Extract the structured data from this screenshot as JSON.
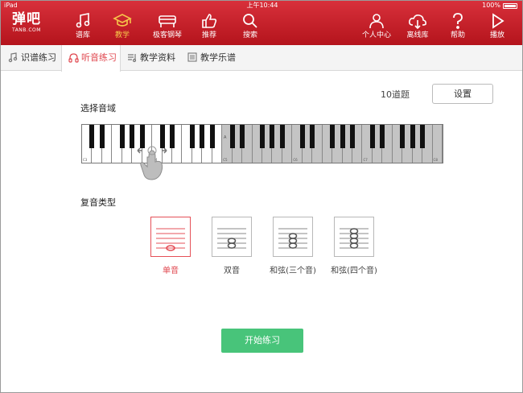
{
  "status": {
    "device": "iPad",
    "time": "上午10:44",
    "battery": "100%"
  },
  "logo": {
    "main": "弹吧",
    "sub": "TANB.COM"
  },
  "nav": {
    "left": [
      {
        "label": "谱库",
        "icon": "music-note-icon"
      },
      {
        "label": "教学",
        "icon": "graduation-cap-icon",
        "active": true
      },
      {
        "label": "极客钢琴",
        "icon": "piano-icon"
      },
      {
        "label": "推荐",
        "icon": "thumbs-up-icon"
      },
      {
        "label": "搜索",
        "icon": "search-icon"
      }
    ],
    "right": [
      {
        "label": "个人中心",
        "icon": "user-icon"
      },
      {
        "label": "离线库",
        "icon": "cloud-download-icon"
      },
      {
        "label": "帮助",
        "icon": "help-icon"
      },
      {
        "label": "播放",
        "icon": "play-icon"
      }
    ]
  },
  "tabs": [
    {
      "label": "识谱练习",
      "icon": "music-note-icon"
    },
    {
      "label": "听音练习",
      "icon": "headphones-icon",
      "active": true
    },
    {
      "label": "教学资料",
      "icon": "document-icon"
    },
    {
      "label": "教学乐谱",
      "icon": "sheet-music-icon"
    }
  ],
  "practice": {
    "count": "10道题",
    "settings": "设置",
    "range_title": "选择音域",
    "type_title": "复音类型",
    "start": "开始练习"
  },
  "keyboard": {
    "labels": [
      "C3",
      "C4",
      "C5",
      "C6",
      "C7",
      "C8"
    ],
    "handle": "A"
  },
  "types": [
    {
      "label": "单音",
      "notes": 1,
      "selected": true
    },
    {
      "label": "双音",
      "notes": 2
    },
    {
      "label": "和弦(三个音)",
      "notes": 3
    },
    {
      "label": "和弦(四个音)",
      "notes": 4
    }
  ],
  "colors": {
    "header": "#c5222b",
    "accent": "#e0464e",
    "active_nav": "#f7c64a",
    "start_button": "#48c47a"
  }
}
